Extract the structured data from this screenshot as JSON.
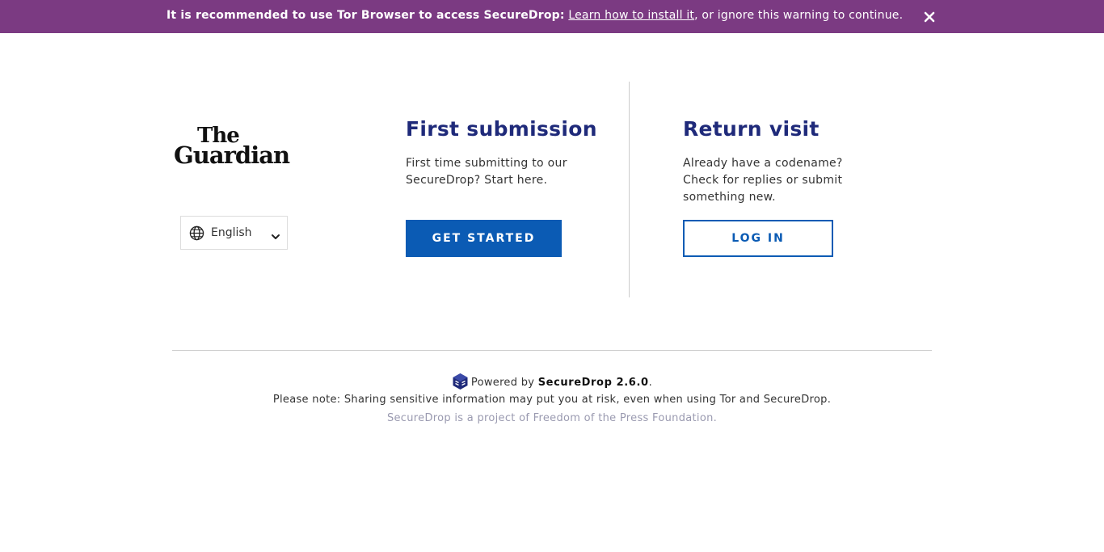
{
  "banner": {
    "bold_text": "It is recommended to use Tor Browser to access SecureDrop:",
    "link_text": "Learn how to install it",
    "tail_text": ", or ignore this warning to continue.",
    "close_icon": "close-icon",
    "background": "#7b3a82"
  },
  "logo": {
    "line1": "The",
    "line2": "Guardian"
  },
  "language": {
    "selected": "English",
    "icon": "globe-icon"
  },
  "first_submission": {
    "title": "First submission",
    "description": "First time submitting to our SecureDrop? Start here.",
    "button_label": "GET STARTED"
  },
  "return_visit": {
    "title": "Return visit",
    "description": "Already have a codename? Check for replies or submit something new.",
    "button_label": "LOG IN"
  },
  "footer": {
    "powered_prefix": "Powered by ",
    "product": "SecureDrop 2.6.0",
    "powered_suffix": ".",
    "note": "Please note: Sharing sensitive information may put you at risk, even when using Tor and SecureDrop.",
    "project": "SecureDrop is a project of Freedom of the Press Foundation."
  },
  "colors": {
    "accent": "#0b5bb4",
    "title": "#1f2a7a"
  }
}
